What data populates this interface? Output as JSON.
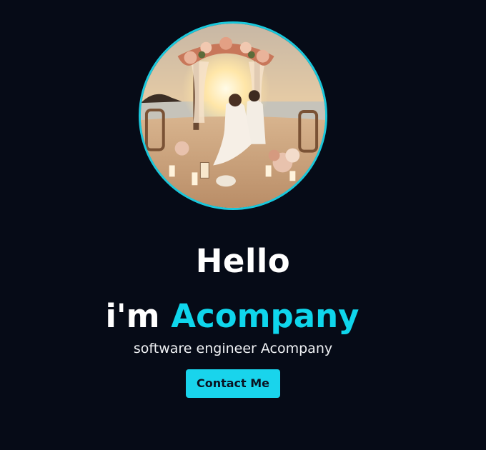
{
  "hero": {
    "avatar_alt": "Wedding couple seated before a flower arch on a beach at sunset",
    "greeting": "Hello",
    "intro_prefix": "i'm ",
    "name": "Acompany",
    "tagline": "software engineer Acompany",
    "contact_button_label": "Contact Me"
  },
  "colors": {
    "background": "#060b17",
    "accent": "#0fd6ec",
    "button": "#19d4ec",
    "text": "#ffffff"
  }
}
